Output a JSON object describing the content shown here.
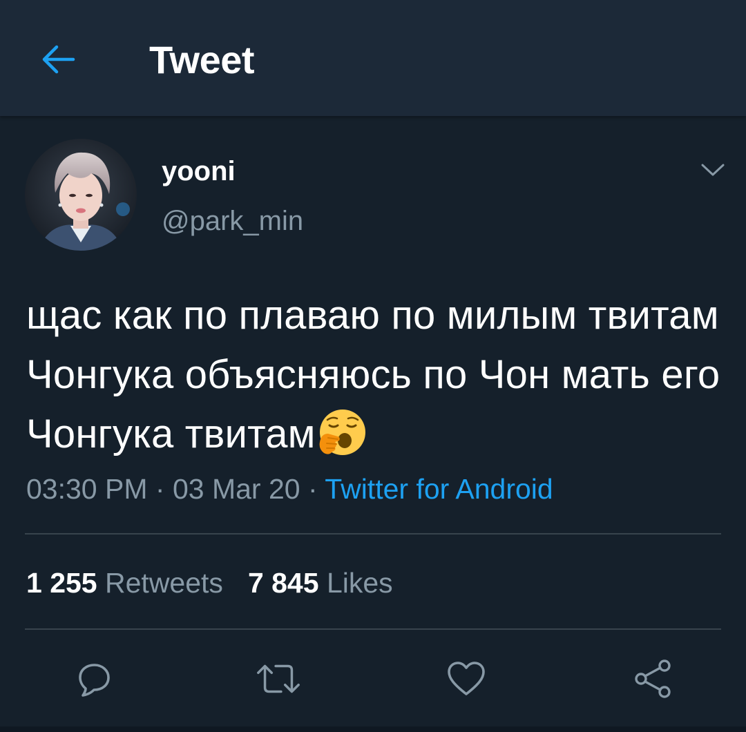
{
  "header": {
    "title": "Tweet",
    "back_icon": "arrow-left-icon"
  },
  "colors": {
    "background": "#15202b",
    "header_bg": "#1c2938",
    "accent": "#1da1f2",
    "secondary_text": "#8899a6",
    "divider": "#38444d"
  },
  "author": {
    "display_name": "yooni",
    "handle": "@park_min",
    "avatar_icon": "profile-photo"
  },
  "tweet": {
    "text": "щас как по плаваю по милым твитам Чонгука объясняюсь по Чон мать его Чонгука твитам",
    "emoji": "yawning-face-emoji",
    "time": "03:30 PM",
    "date": "03 Mar 20",
    "separator": "·",
    "source": "Twitter for Android"
  },
  "stats": {
    "retweets_count": "1 255",
    "retweets_label": "Retweets",
    "likes_count": "7 845",
    "likes_label": "Likes"
  },
  "actions": {
    "reply_icon": "reply-icon",
    "retweet_icon": "retweet-icon",
    "like_icon": "heart-icon",
    "share_icon": "share-icon"
  }
}
